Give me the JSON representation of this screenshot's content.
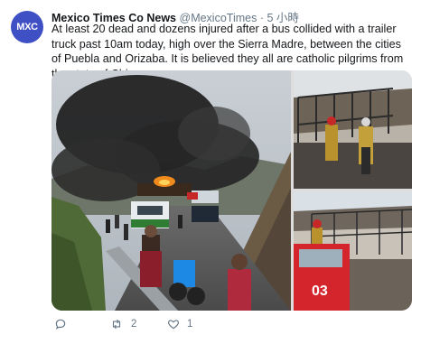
{
  "tweet": {
    "avatar_text": "MXC",
    "author_name": "Mexico Times Co News",
    "handle": "@MexicoTimes",
    "separator": "·",
    "time": "5 小時",
    "text": "At least 20 dead and dozens injured after a bus collided with a trailer truck past 10am today, high over the Sierra Madre, between the cities of Puebla and Orizaba. It is believed they all are catholic pilgrims from the state of Chiapas.",
    "truck_number": "03"
  },
  "actions": {
    "retweet_count": "2",
    "like_count": "1"
  },
  "colors": {
    "avatar_bg": "#3f4fc4",
    "muted_text": "#657786"
  }
}
